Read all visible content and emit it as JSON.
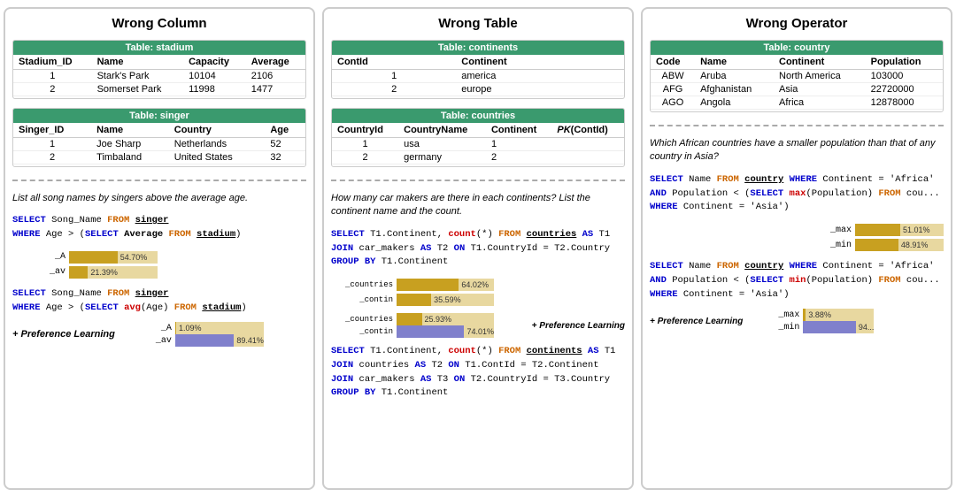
{
  "panel1": {
    "title": "Wrong Column",
    "table_stadium": {
      "name": "Table: stadium",
      "columns": [
        "Stadium_ID",
        "Name",
        "Capacity",
        "Average"
      ],
      "rows": [
        [
          "1",
          "Stark's Park",
          "10104",
          "2106"
        ],
        [
          "2",
          "Somerset Park",
          "11998",
          "1477"
        ]
      ]
    },
    "table_singer": {
      "name": "Table: singer",
      "columns": [
        "Singer_ID",
        "Name",
        "Country",
        "Age"
      ],
      "rows": [
        [
          "1",
          "Joe Sharp",
          "Netherlands",
          "52"
        ],
        [
          "2",
          "Timbaland",
          "United States",
          "32"
        ]
      ]
    },
    "question": "List all song names by singers above the average age.",
    "sql1": {
      "line1": "SELECT Song_Name FROM singer",
      "line2": "WHERE Age > (SELECT Average FROM stadium)"
    },
    "bar1_label_a": "_A",
    "bar1_pct_a": "54.70%",
    "bar1_label_av": "_av",
    "bar1_pct_av": "21.39%",
    "sql2": {
      "line1": "SELECT Song_Name FROM singer",
      "line2": "WHERE Age > (SELECT avg(Age) FROM stadium)"
    },
    "pref_label": "+ Preference Learning",
    "bar2_label_a": "_A",
    "bar2_pct_a": "1.09%",
    "bar2_label_av": "_av",
    "bar2_pct_av": "89.41%"
  },
  "panel2": {
    "title": "Wrong Table",
    "table_continents": {
      "name": "Table: continents",
      "columns": [
        "ContId",
        "Continent"
      ],
      "rows": [
        [
          "1",
          "america"
        ],
        [
          "2",
          "europe"
        ]
      ]
    },
    "table_countries": {
      "name": "Table: countries",
      "columns": [
        "CountryId",
        "CountryName",
        "Continent",
        "PK(ContId)"
      ],
      "rows": [
        [
          "1",
          "usa",
          "1",
          ""
        ],
        [
          "2",
          "germany",
          "2",
          ""
        ]
      ]
    },
    "question": "How many car makers are there in each continents? List the continent name and the count.",
    "sql1": {
      "line1": "SELECT T1.Continent, count(*) FROM countries AS T1",
      "line2": "JOIN car_makers AS T2 ON T1.CountryId = T2.Country",
      "line3": "GROUP BY T1.Continent"
    },
    "bar1_label_countries": "_countries",
    "bar1_pct_countries": "64.02%",
    "bar1_label_contin": "_contin",
    "bar1_pct_contin": "35.59%",
    "pref_label": "+ Preference Learning",
    "bar2_label_countries": "_countries",
    "bar2_pct_countries": "25.93%",
    "bar2_label_contin": "_contin",
    "bar2_pct_contin": "74.01%",
    "sql2": {
      "line1": "SELECT T1.Continent, count(*) FROM continents AS T1",
      "line2": "JOIN countries AS T2 ON T1.ContId = T2.Continent",
      "line3": "JOIN car_makers AS T3 ON T2.CountryId = T3.Country",
      "line4": "GROUP BY T1.Continent"
    }
  },
  "panel3": {
    "title": "Wrong Operator",
    "table_country": {
      "name": "Table: country",
      "columns": [
        "Code",
        "Name",
        "Continent",
        "Population"
      ],
      "rows": [
        [
          "ABW",
          "Aruba",
          "North America",
          "103000"
        ],
        [
          "AFG",
          "Afghanistan",
          "Asia",
          "22720000"
        ],
        [
          "AGO",
          "Angola",
          "Africa",
          "12878000"
        ]
      ]
    },
    "question": "Which African countries have a smaller population than that of any country in Asia?",
    "sql1": {
      "line1": "SELECT Name FROM country WHERE Continent = 'Africa'",
      "line2": "AND Population < (SELECT max(Population) FROM cou...",
      "line3": "WHERE Continent = 'Asia')"
    },
    "bar1_label_max": "_max",
    "bar1_pct_max": "51.01%",
    "bar1_label_min": "_min",
    "bar1_pct_min": "48.91%",
    "sql2": {
      "line1": "SELECT Name FROM country WHERE Continent = 'Africa'",
      "line2": "AND Population < (SELECT min(Population) FROM cou...",
      "line3": "WHERE Continent = 'Asia')"
    },
    "pref_label": "+ Preference Learning",
    "bar2_label_max": "_max",
    "bar2_pct_max": "3.88%",
    "bar2_label_min": "_min",
    "bar2_pct_min": "94..."
  }
}
